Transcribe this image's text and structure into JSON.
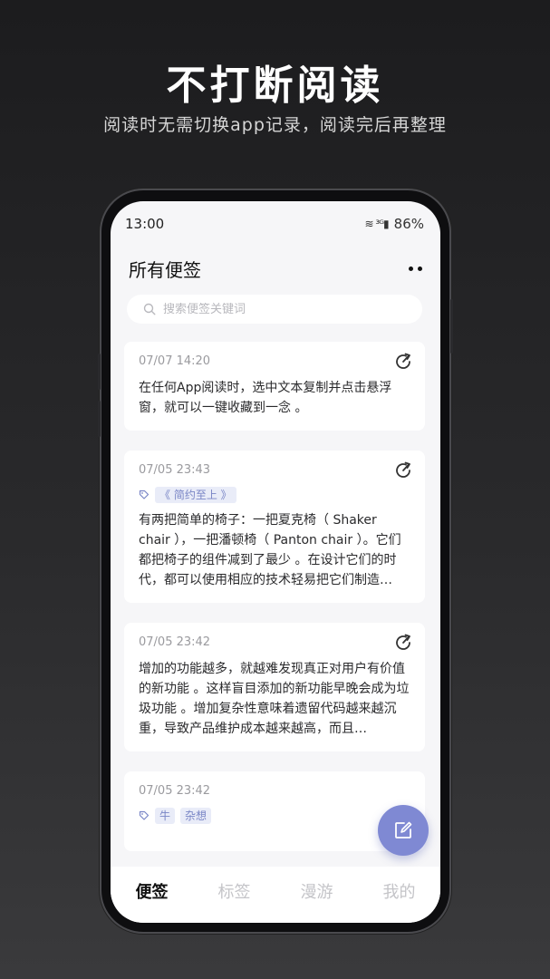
{
  "promo": {
    "title": "不打断阅读",
    "subtitle": "阅读时无需切换app记录，阅读完后再整理"
  },
  "status_bar": {
    "time": "13:00",
    "network_icons": "≋ ³ᴳ▮",
    "battery": "86%"
  },
  "header": {
    "title": "所有便签",
    "more_icon": "more-dots-icon"
  },
  "search": {
    "placeholder": "搜索便签关键词",
    "value": ""
  },
  "notes": [
    {
      "date": "07/07 14:20",
      "tags": [],
      "text": "在任何App阅读时，选中文本复制并点击悬浮窗，就可以一键收藏到一念 。"
    },
    {
      "date": "07/05 23:43",
      "tags": [
        "《 简约至上 》"
      ],
      "text": "有两把简单的椅子：一把夏克椅（ Shaker chair ），一把潘顿椅（ Panton chair ）。它们都把椅子的组件减到了最少 。在设计它们的时代，都可以使用相应的技术轻易把它们制造…"
    },
    {
      "date": "07/05 23:42",
      "tags": [],
      "text": "增加的功能越多，就越难发现真正对用户有价值的新功能 。这样盲目添加的新功能早晚会成为垃圾功能 。增加复杂性意味着遗留代码越来越沉重，导致产品维护成本越来越高，而且…"
    },
    {
      "date": "07/05 23:42",
      "tags": [
        "牛",
        "杂想"
      ],
      "text": ""
    }
  ],
  "tabs": [
    {
      "label": "便签",
      "active": true
    },
    {
      "label": "标签",
      "active": false
    },
    {
      "label": "漫游",
      "active": false
    },
    {
      "label": "我的",
      "active": false
    }
  ],
  "colors": {
    "accent": "#7f89d3",
    "tag_text": "#7a86c6",
    "tag_bg": "#e9ecf8"
  }
}
